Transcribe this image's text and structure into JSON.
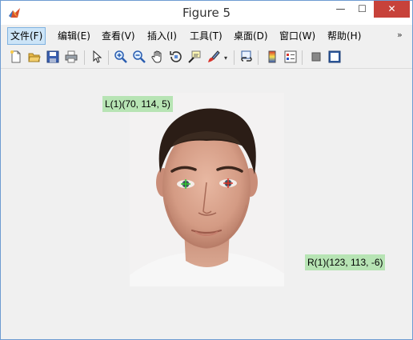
{
  "window": {
    "title": "Figure 5",
    "controls": {
      "minimize": "—",
      "maximize": "☐",
      "close": "✕"
    }
  },
  "menu": {
    "items": [
      {
        "label": "文件(F)"
      },
      {
        "label": "编辑(E)"
      },
      {
        "label": "查看(V)"
      },
      {
        "label": "插入(I)"
      },
      {
        "label": "工具(T)"
      },
      {
        "label": "桌面(D)"
      },
      {
        "label": "窗口(W)"
      },
      {
        "label": "帮助(H)"
      }
    ],
    "overflow": "»"
  },
  "toolbar": {
    "icons": [
      "new-figure-icon",
      "open-folder-icon",
      "save-icon",
      "print-icon",
      "pointer-icon",
      "zoom-in-icon",
      "zoom-out-icon",
      "pan-hand-icon",
      "rotate-3d-icon",
      "data-cursor-icon",
      "brush-icon",
      "link-plot-icon",
      "colorbar-icon",
      "legend-icon",
      "hide-tools-icon",
      "show-tools-icon"
    ]
  },
  "annotations": {
    "left": "L(1)(70, 114, 5)",
    "right": "R(1)(123, 113, -6)"
  },
  "colors": {
    "label_bg": "#b7e4b4",
    "menu_active_bg": "#cce4f7",
    "close_button": "#c7423a",
    "left_marker": "#38d03a",
    "right_marker": "#e23a2e"
  }
}
